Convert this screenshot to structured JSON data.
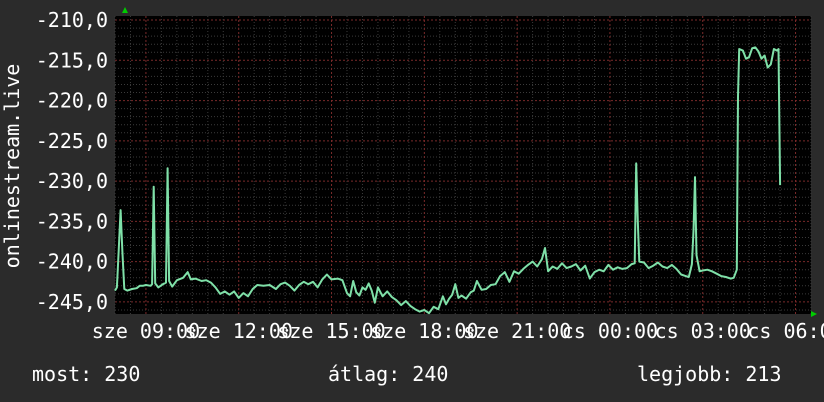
{
  "chart_data": {
    "type": "line",
    "ylabel": "onlinestream.live",
    "ylim": [
      -246.5,
      -209.5
    ],
    "y_ticks": [
      "-210,0",
      "-215,0",
      "-220,0",
      "-225,0",
      "-230,0",
      "-235,0",
      "-240,0",
      "-245,0"
    ],
    "y_tick_values": [
      -210,
      -215,
      -220,
      -225,
      -230,
      -235,
      -240,
      -245
    ],
    "xlim": [
      8.0,
      30.5
    ],
    "x_ticks": [
      "sze 09:00",
      "sze 12:00",
      "sze 15:00",
      "sze 18:00",
      "sze 21:00",
      "cs 00:00",
      "cs 03:00",
      "cs 06:00"
    ],
    "x_tick_values": [
      9,
      12,
      15,
      18,
      21,
      24,
      27,
      30
    ],
    "grid": true,
    "line_color": "#7fe0a8",
    "series": [
      {
        "values": [
          [
            8.0,
            -243.6
          ],
          [
            8.06,
            -243.2
          ],
          [
            8.12,
            -238.6
          ],
          [
            8.18,
            -233.6
          ],
          [
            8.24,
            -238.8
          ],
          [
            8.3,
            -243.4
          ],
          [
            8.4,
            -243.6
          ],
          [
            8.55,
            -243.4
          ],
          [
            8.7,
            -243.3
          ],
          [
            8.8,
            -243.0
          ],
          [
            8.9,
            -243.0
          ],
          [
            9.0,
            -242.9
          ],
          [
            9.15,
            -243.0
          ],
          [
            9.2,
            -242.8
          ],
          [
            9.25,
            -230.7
          ],
          [
            9.3,
            -242.7
          ],
          [
            9.4,
            -243.2
          ],
          [
            9.55,
            -242.8
          ],
          [
            9.65,
            -242.6
          ],
          [
            9.7,
            -228.4
          ],
          [
            9.75,
            -242.4
          ],
          [
            9.85,
            -243.1
          ],
          [
            10.0,
            -242.3
          ],
          [
            10.2,
            -242.0
          ],
          [
            10.35,
            -241.3
          ],
          [
            10.45,
            -242.2
          ],
          [
            10.6,
            -242.1
          ],
          [
            10.8,
            -242.4
          ],
          [
            10.95,
            -242.3
          ],
          [
            11.1,
            -242.6
          ],
          [
            11.25,
            -243.2
          ],
          [
            11.4,
            -244.0
          ],
          [
            11.55,
            -243.7
          ],
          [
            11.7,
            -244.1
          ],
          [
            11.85,
            -243.7
          ],
          [
            12.0,
            -244.5
          ],
          [
            12.15,
            -243.9
          ],
          [
            12.3,
            -244.3
          ],
          [
            12.45,
            -243.4
          ],
          [
            12.6,
            -242.9
          ],
          [
            12.8,
            -243.0
          ],
          [
            13.0,
            -242.9
          ],
          [
            13.2,
            -243.4
          ],
          [
            13.35,
            -242.8
          ],
          [
            13.5,
            -242.6
          ],
          [
            13.65,
            -243.0
          ],
          [
            13.8,
            -243.6
          ],
          [
            13.95,
            -242.9
          ],
          [
            14.1,
            -242.5
          ],
          [
            14.25,
            -242.8
          ],
          [
            14.4,
            -242.5
          ],
          [
            14.55,
            -243.2
          ],
          [
            14.7,
            -242.2
          ],
          [
            14.85,
            -241.6
          ],
          [
            15.0,
            -242.2
          ],
          [
            15.2,
            -242.1
          ],
          [
            15.35,
            -242.3
          ],
          [
            15.5,
            -243.9
          ],
          [
            15.6,
            -244.3
          ],
          [
            15.7,
            -242.4
          ],
          [
            15.8,
            -243.8
          ],
          [
            15.9,
            -244.2
          ],
          [
            16.0,
            -243.2
          ],
          [
            16.1,
            -243.5
          ],
          [
            16.2,
            -242.7
          ],
          [
            16.3,
            -243.6
          ],
          [
            16.4,
            -245.1
          ],
          [
            16.5,
            -243.2
          ],
          [
            16.65,
            -244.3
          ],
          [
            16.8,
            -243.7
          ],
          [
            16.95,
            -244.4
          ],
          [
            17.1,
            -244.8
          ],
          [
            17.25,
            -245.4
          ],
          [
            17.4,
            -244.9
          ],
          [
            17.55,
            -245.5
          ],
          [
            17.7,
            -245.9
          ],
          [
            17.85,
            -246.2
          ],
          [
            18.0,
            -246.0
          ],
          [
            18.15,
            -246.4
          ],
          [
            18.3,
            -245.6
          ],
          [
            18.45,
            -245.9
          ],
          [
            18.6,
            -244.3
          ],
          [
            18.7,
            -245.3
          ],
          [
            18.8,
            -244.6
          ],
          [
            18.9,
            -244.1
          ],
          [
            19.0,
            -242.8
          ],
          [
            19.1,
            -244.5
          ],
          [
            19.2,
            -244.2
          ],
          [
            19.35,
            -244.6
          ],
          [
            19.5,
            -243.8
          ],
          [
            19.6,
            -243.6
          ],
          [
            19.7,
            -242.4
          ],
          [
            19.85,
            -243.5
          ],
          [
            20.0,
            -243.4
          ],
          [
            20.15,
            -242.9
          ],
          [
            20.3,
            -242.8
          ],
          [
            20.45,
            -241.8
          ],
          [
            20.6,
            -241.3
          ],
          [
            20.75,
            -242.5
          ],
          [
            20.9,
            -241.2
          ],
          [
            21.05,
            -241.5
          ],
          [
            21.2,
            -240.9
          ],
          [
            21.35,
            -240.4
          ],
          [
            21.5,
            -240.0
          ],
          [
            21.65,
            -240.6
          ],
          [
            21.8,
            -239.7
          ],
          [
            21.9,
            -238.3
          ],
          [
            22.0,
            -241.2
          ],
          [
            22.15,
            -240.6
          ],
          [
            22.3,
            -240.9
          ],
          [
            22.45,
            -240.2
          ],
          [
            22.6,
            -240.8
          ],
          [
            22.75,
            -240.6
          ],
          [
            22.9,
            -240.3
          ],
          [
            23.05,
            -241.1
          ],
          [
            23.2,
            -240.5
          ],
          [
            23.35,
            -242.1
          ],
          [
            23.5,
            -241.3
          ],
          [
            23.65,
            -241.0
          ],
          [
            23.8,
            -241.2
          ],
          [
            23.95,
            -240.4
          ],
          [
            24.1,
            -241.0
          ],
          [
            24.25,
            -240.7
          ],
          [
            24.4,
            -240.9
          ],
          [
            24.55,
            -240.8
          ],
          [
            24.7,
            -240.3
          ],
          [
            24.8,
            -240.2
          ],
          [
            24.85,
            -227.8
          ],
          [
            24.9,
            -235.0
          ],
          [
            24.95,
            -240.0
          ],
          [
            25.1,
            -240.1
          ],
          [
            25.25,
            -240.8
          ],
          [
            25.4,
            -240.5
          ],
          [
            25.55,
            -240.1
          ],
          [
            25.7,
            -240.6
          ],
          [
            25.85,
            -240.8
          ],
          [
            26.0,
            -240.4
          ],
          [
            26.15,
            -240.9
          ],
          [
            26.3,
            -241.6
          ],
          [
            26.45,
            -241.8
          ],
          [
            26.55,
            -241.9
          ],
          [
            26.65,
            -240.3
          ],
          [
            26.7,
            -236.2
          ],
          [
            26.75,
            -229.5
          ],
          [
            26.8,
            -239.2
          ],
          [
            26.9,
            -241.2
          ],
          [
            27.0,
            -241.1
          ],
          [
            27.15,
            -241.0
          ],
          [
            27.3,
            -241.2
          ],
          [
            27.45,
            -241.5
          ],
          [
            27.6,
            -241.8
          ],
          [
            27.75,
            -241.9
          ],
          [
            27.9,
            -242.1
          ],
          [
            28.0,
            -242.0
          ],
          [
            28.1,
            -241.0
          ],
          [
            28.14,
            -219.5
          ],
          [
            28.18,
            -213.6
          ],
          [
            28.3,
            -213.8
          ],
          [
            28.4,
            -214.8
          ],
          [
            28.5,
            -214.6
          ],
          [
            28.6,
            -213.5
          ],
          [
            28.7,
            -213.4
          ],
          [
            28.8,
            -213.9
          ],
          [
            28.9,
            -214.8
          ],
          [
            29.0,
            -214.4
          ],
          [
            29.1,
            -215.9
          ],
          [
            29.2,
            -215.5
          ],
          [
            29.3,
            -213.6
          ],
          [
            29.4,
            -213.8
          ],
          [
            29.45,
            -213.6
          ],
          [
            29.5,
            -230.5
          ]
        ]
      }
    ]
  },
  "stats": {
    "current": "most: 230",
    "average": "átlag: 240",
    "best": "legjobb: 213"
  }
}
